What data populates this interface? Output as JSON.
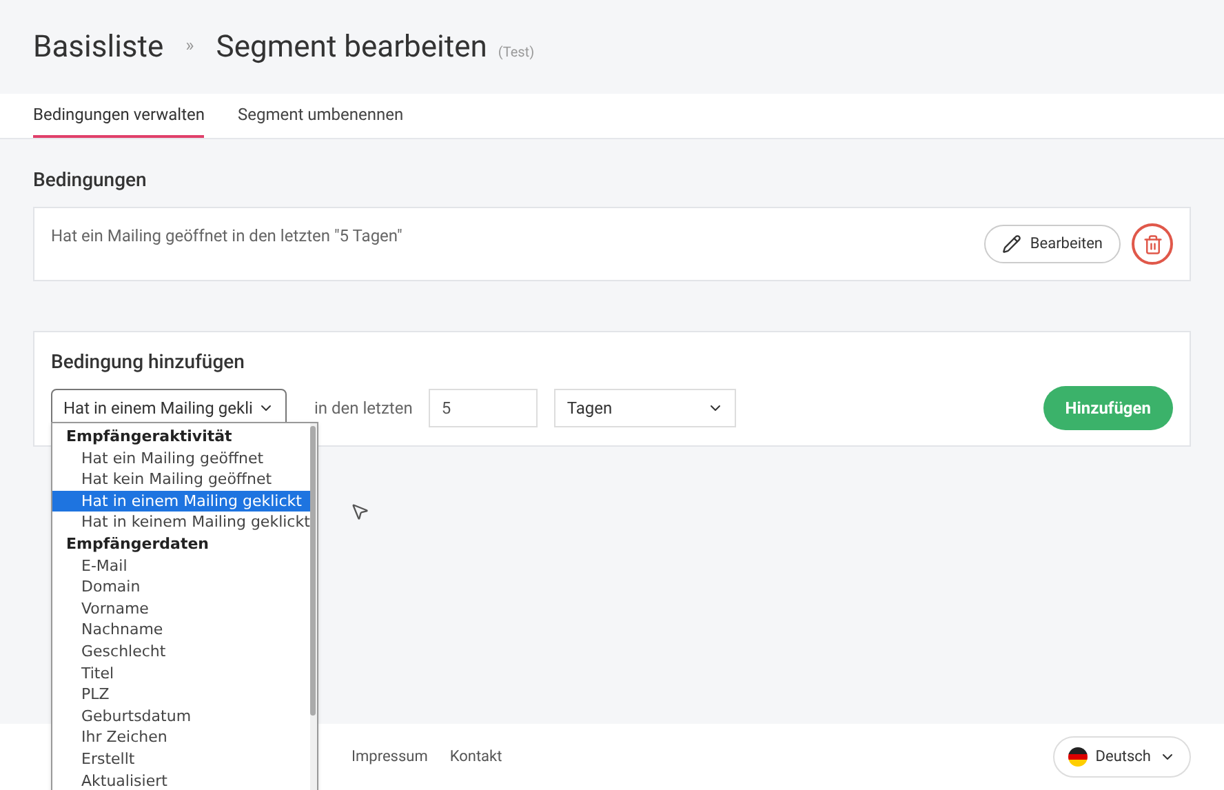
{
  "breadcrumb": {
    "parent": "Basisliste",
    "separator": "»",
    "title": "Segment bearbeiten",
    "note": "(Test)"
  },
  "tabs": [
    {
      "label": "Bedingungen verwalten",
      "selected": true
    },
    {
      "label": "Segment umbenennen",
      "selected": false
    }
  ],
  "conditions": {
    "heading": "Bedingungen",
    "items": [
      {
        "text": "Hat ein Mailing geöffnet in den letzten \"5 Tagen\"",
        "edit_label": "Bearbeiten"
      }
    ]
  },
  "add_condition": {
    "heading": "Bedingung hinzufügen",
    "type_select": "Hat in einem Mailing gekli",
    "period_label": "in den letzten",
    "amount": "5",
    "unit_select": "Tagen",
    "submit": "Hinzufügen"
  },
  "dropdown": [
    {
      "kind": "group",
      "label": "Empfängeraktivität"
    },
    {
      "kind": "option",
      "label": "Hat ein Mailing geöffnet",
      "selected": false
    },
    {
      "kind": "option",
      "label": "Hat kein Mailing geöffnet",
      "selected": false
    },
    {
      "kind": "option",
      "label": "Hat in einem Mailing geklickt",
      "selected": true
    },
    {
      "kind": "option",
      "label": "Hat in keinem Mailing geklickt",
      "selected": false
    },
    {
      "kind": "group",
      "label": "Empfängerdaten"
    },
    {
      "kind": "option",
      "label": "E-Mail",
      "selected": false
    },
    {
      "kind": "option",
      "label": "Domain",
      "selected": false
    },
    {
      "kind": "option",
      "label": "Vorname",
      "selected": false
    },
    {
      "kind": "option",
      "label": "Nachname",
      "selected": false
    },
    {
      "kind": "option",
      "label": "Geschlecht",
      "selected": false
    },
    {
      "kind": "option",
      "label": "Titel",
      "selected": false
    },
    {
      "kind": "option",
      "label": "PLZ",
      "selected": false
    },
    {
      "kind": "option",
      "label": "Geburtsdatum",
      "selected": false
    },
    {
      "kind": "option",
      "label": "Ihr Zeichen",
      "selected": false
    },
    {
      "kind": "option",
      "label": "Erstellt",
      "selected": false
    },
    {
      "kind": "option",
      "label": "Aktualisiert",
      "selected": false
    }
  ],
  "footer": {
    "links": [
      "Impressum",
      "Kontakt"
    ],
    "language": "Deutsch"
  }
}
